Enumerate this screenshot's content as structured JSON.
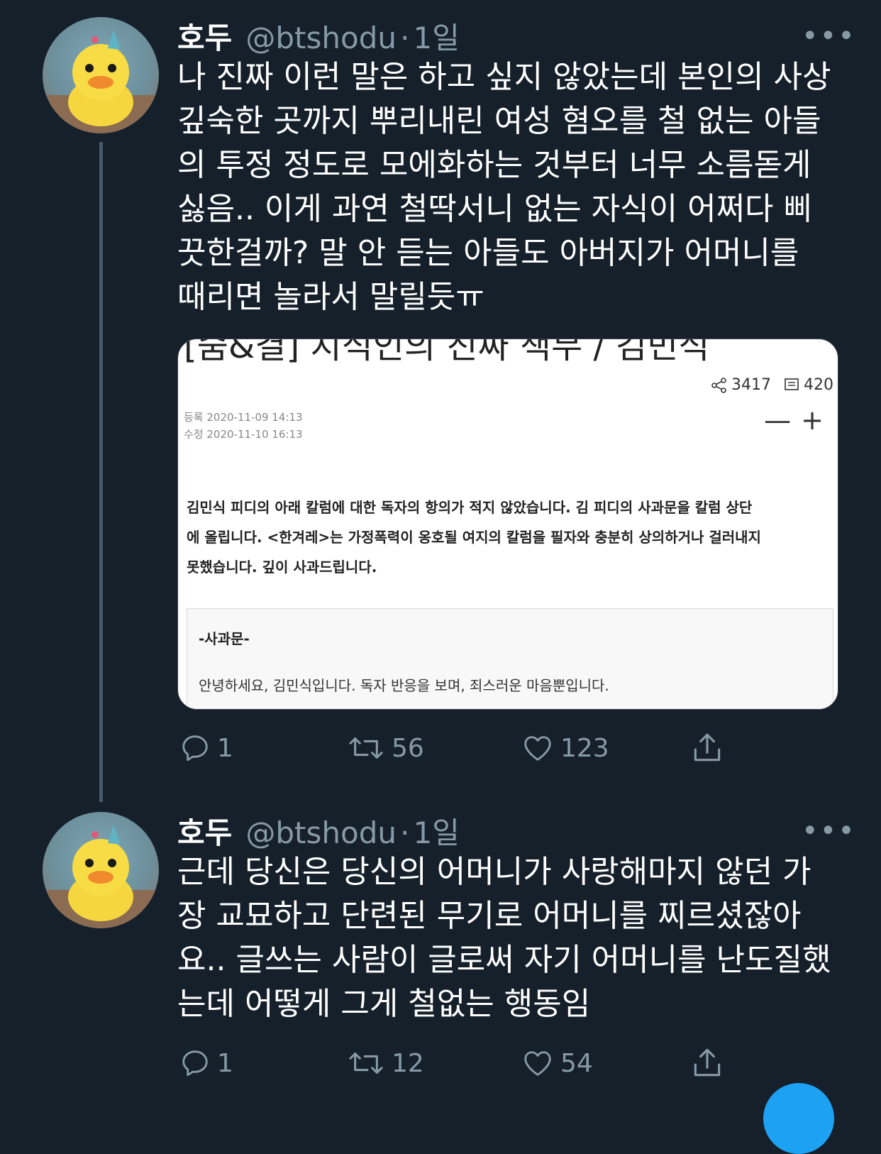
{
  "tweets": [
    {
      "name": "호두",
      "handle": "@btshodu",
      "separator": "·",
      "time": "1일",
      "more": "•••",
      "text": "나 진짜 이런 말은 하고 싶지 않았는데 본인의 사상\n깊숙한 곳까지 뿌리내린 여성 혐오를 철 없는 아들\n의 투정 정도로 모에화하는 것부터 너무 소름돋게\n싫음.. 이게 과연 철딱서니 없는 자식이 어쩌다 삐\n끗한걸까? 말 안 듣는 아들도 아버지가 어머니를\n때리면 놀라서 말릴듯ㅠ",
      "replies": "1",
      "retweets": "56",
      "likes": "123",
      "card": {
        "title": "[숨&결] 지식인의 진짜 책무 / 김민식",
        "shares": "3417",
        "comments": "420",
        "registered": "등록 2020-11-09 14:13",
        "modified": "수정 2020-11-10 16:13",
        "zoom_out": "—",
        "zoom_in": "+",
        "notice": "김민식 피디의 아래 칼럼에 대한 독자의 항의가 적지 않았습니다. 김 피디의 사과문을 칼럼 상단\n에 올립니다. <한겨레>는 가정폭력이 옹호될 여지의 칼럼을 필자와 충분히 상의하거나 걸러내지\n못했습니다. 깊이 사과드립니다.",
        "apology_title": "-사과문-",
        "apology_text": "안녕하세요, 김민식입니다. 독자 반응을 보며, 죄스러운 마음뿐입니다."
      }
    },
    {
      "name": "호두",
      "handle": "@btshodu",
      "separator": "·",
      "time": "1일",
      "more": "•••",
      "text": "근데 당신은 당신의 어머니가 사랑해마지 않던 가\n장 교묘하고 단련된 무기로 어머니를 찌르셨잖아\n요.. 글쓰는 사람이 글로써 자기 어머니를 난도질했\n는데 어떻게 그게 철없는 행동임",
      "replies": "1",
      "retweets": "12",
      "likes": "54"
    }
  ],
  "icons": [
    "reply-icon",
    "retweet-icon",
    "like-icon",
    "share-icon",
    "more-icon"
  ],
  "colors": {
    "background": "#15202b",
    "muted": "#8899a6",
    "thread_line": "#425a6b"
  }
}
